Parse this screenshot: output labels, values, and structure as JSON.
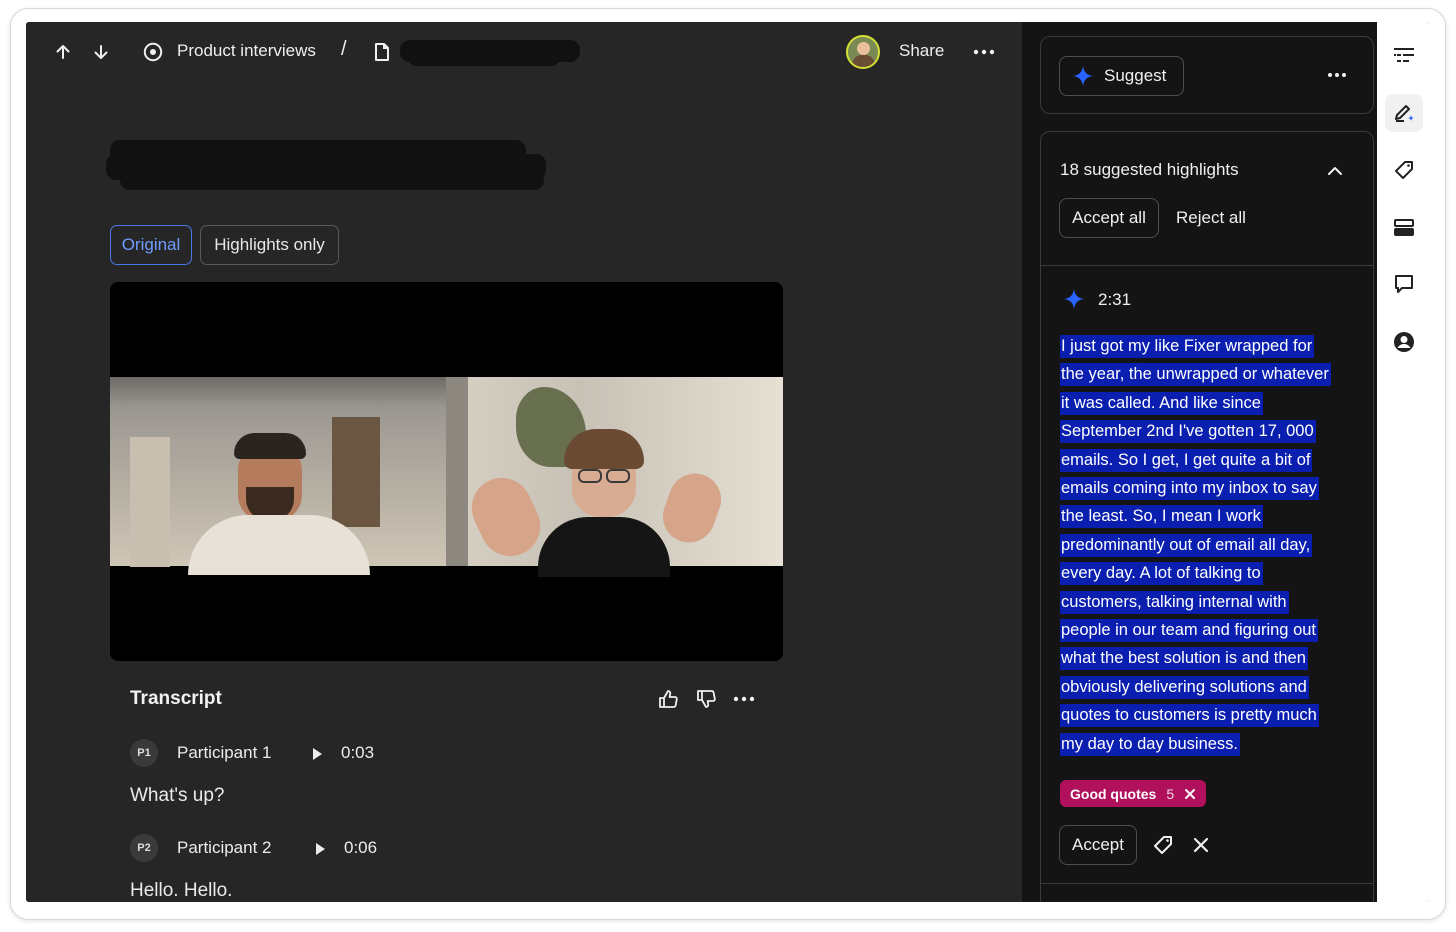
{
  "topbar": {
    "breadcrumb_folder": "Product interviews",
    "breadcrumb_sep": "/",
    "share_label": "Share",
    "icons": [
      "arrow-up-icon",
      "arrow-down-icon",
      "compass-icon",
      "document-icon",
      "avatar",
      "more-icon"
    ]
  },
  "view_tabs": [
    {
      "label": "Original",
      "active": true
    },
    {
      "label": "Highlights only",
      "active": false
    }
  ],
  "transcript": {
    "title": "Transcript",
    "entries": [
      {
        "badge": "P1",
        "speaker": "Participant 1",
        "time": "0:03",
        "text": "What's up?"
      },
      {
        "badge": "P2",
        "speaker": "Participant 2",
        "time": "0:06",
        "text": "Hello. Hello."
      }
    ]
  },
  "panel": {
    "suggest_label": "Suggest",
    "suggestions_title": "18 suggested highlights",
    "accept_all_label": "Accept all",
    "reject_all_label": "Reject all",
    "highlight": {
      "time": "2:31",
      "lines": [
        "I just got my like Fixer wrapped for",
        "the year, the unwrapped or whatever",
        "it was called. And like since",
        "September 2nd I've gotten 17, 000",
        "emails. So I get, I get quite a bit of",
        "emails coming into my inbox to say",
        "the least. So, I mean I work",
        "predominantly out of email all day,",
        "every day. A lot of talking to",
        "customers, talking internal with",
        "people in our team and figuring out",
        "what the best solution is and then",
        "obviously delivering solutions and",
        "quotes to customers is pretty much",
        "my day to day business."
      ],
      "tag_label": "Good quotes",
      "tag_count": "5",
      "accept_label": "Accept"
    }
  },
  "colors": {
    "accent_blue": "#4a79e6",
    "highlight_bg": "#0a1fb0",
    "tag_bg": "#b0105c",
    "sparkle": "#2a63ff"
  },
  "rail": {
    "icons": [
      "list-icon",
      "edit-sparkle-icon",
      "tag-icon",
      "rows-icon",
      "comment-icon",
      "user-circle-icon"
    ]
  }
}
